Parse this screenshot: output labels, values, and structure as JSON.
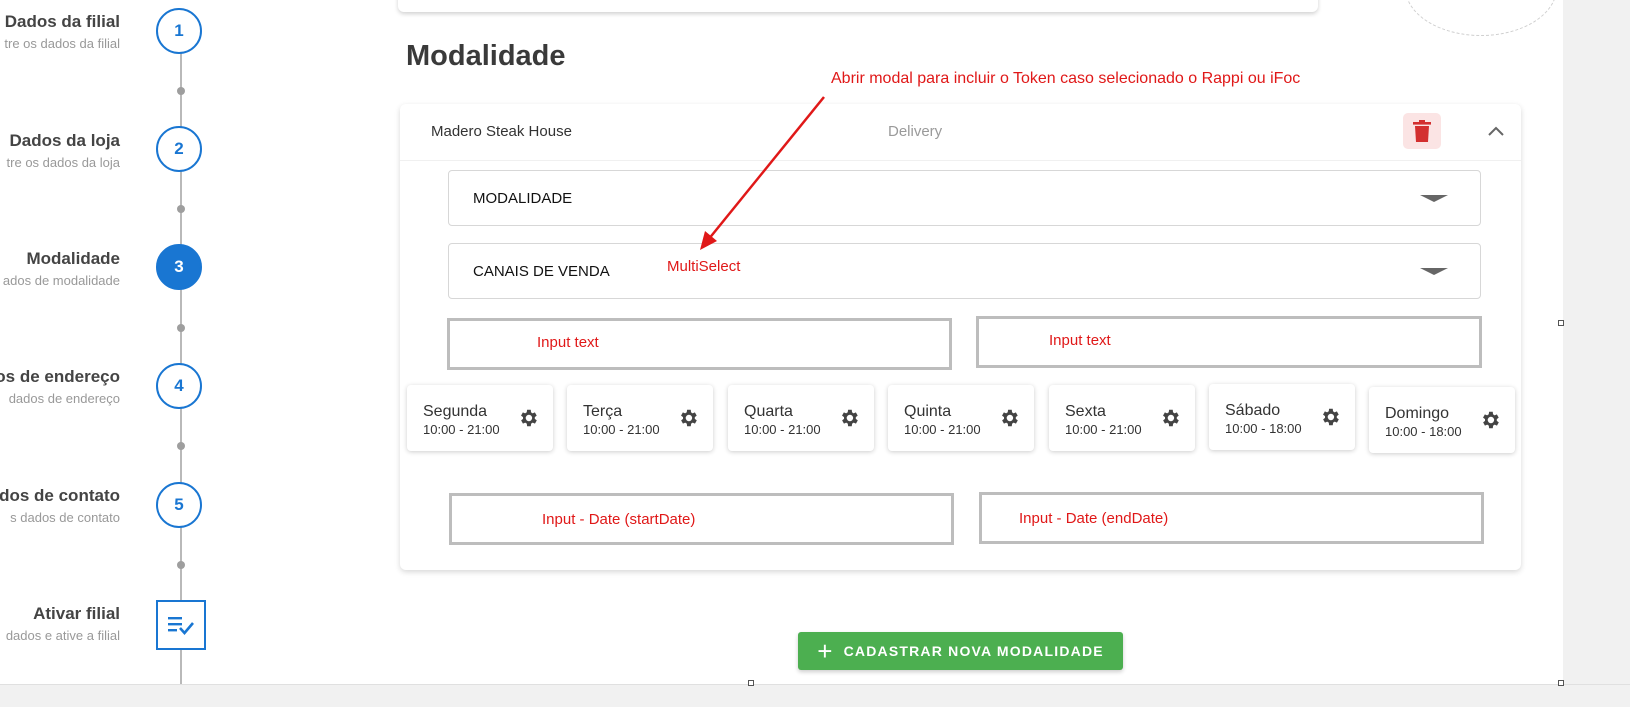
{
  "stepper": {
    "steps": [
      {
        "number": "1",
        "title": "Dados da filial",
        "subtitle": "tre os dados da filial"
      },
      {
        "number": "2",
        "title": "Dados da loja",
        "subtitle": "tre os dados da loja"
      },
      {
        "number": "3",
        "title": "Modalidade",
        "subtitle": "ados de modalidade"
      },
      {
        "number": "4",
        "title": "os de endereço",
        "subtitle": "dados de endereço"
      },
      {
        "number": "5",
        "title": "ados de contato",
        "subtitle": "s dados de contato"
      },
      {
        "number": "",
        "title": "Ativar filial",
        "subtitle": "dados e ative a filial"
      }
    ],
    "active_step": 3
  },
  "section_title": "Modalidade",
  "annotations": {
    "token_note": "Abrir modal para incluir o Token caso selecionado o Rappi ou iFoc",
    "multiselect": "MultiSelect",
    "input_text_1": "Input text",
    "input_text_2": "Input text",
    "date_start": "Input - Date (startDate)",
    "date_end": "Input - Date (endDate)"
  },
  "card": {
    "store_name": "Madero Steak House",
    "modality_type": "Delivery",
    "modalidade_label": "MODALIDADE",
    "canais_label": "CANAIS DE VENDA"
  },
  "days": [
    {
      "name": "Segunda",
      "hours": "10:00 - 21:00"
    },
    {
      "name": "Terça",
      "hours": "10:00 - 21:00"
    },
    {
      "name": "Quarta",
      "hours": "10:00 - 21:00"
    },
    {
      "name": "Quinta",
      "hours": "10:00 - 21:00"
    },
    {
      "name": "Sexta",
      "hours": "10:00 - 21:00"
    },
    {
      "name": "Sábado",
      "hours": "10:00 - 18:00"
    },
    {
      "name": "Domingo",
      "hours": "10:00 - 18:00"
    }
  ],
  "add_button_label": "CADASTRAR NOVA MODALIDADE",
  "colors": {
    "primary": "#1976d2",
    "success": "#4caf50",
    "annotation": "#e01818",
    "danger": "#d32f2f"
  }
}
